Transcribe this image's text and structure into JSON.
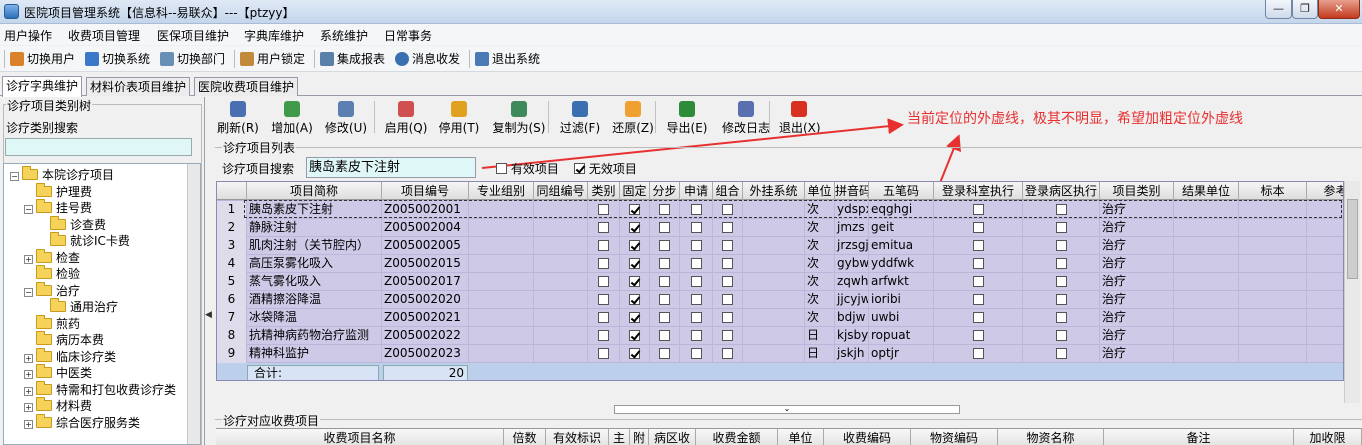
{
  "window": {
    "title": "医院项目管理系统【信息科--易联众】---【ptzyy】",
    "min_label": "—",
    "max_label": "❐",
    "close_label": "✕"
  },
  "menu": [
    "用户操作",
    "收费项目管理",
    "医保项目维护",
    "字典库维护",
    "系统维护",
    "日常事务"
  ],
  "toolbar": [
    {
      "label": "切换用户",
      "icon": "switch-user-icon",
      "color": "#d9822b"
    },
    {
      "label": "切换系统",
      "icon": "switch-system-icon",
      "color": "#3b78c8"
    },
    {
      "label": "切换部门",
      "icon": "switch-dept-icon",
      "color": "#6a8fb7"
    },
    {
      "label": "用户锁定",
      "icon": "user-lock-icon",
      "color": "#c28a3a"
    },
    {
      "label": "集成报表",
      "icon": "report-icon",
      "color": "#5a7fa8"
    },
    {
      "label": "消息收发",
      "icon": "info-icon",
      "color": "#3a6fb0"
    },
    {
      "label": "退出系统",
      "icon": "exit-icon",
      "color": "#4a7ab5"
    }
  ],
  "tabs": [
    "诊疗字典维护",
    "材料价表项目维护",
    "医院收费项目维护"
  ],
  "left": {
    "group_title": "诊疗项目类别树",
    "search_label": "诊疗类别搜索",
    "tree": [
      {
        "label": "本院诊疗项目",
        "level": 0,
        "exp": "−"
      },
      {
        "label": "护理费",
        "level": 1,
        "exp": ""
      },
      {
        "label": "挂号费",
        "level": 1,
        "exp": "−"
      },
      {
        "label": "诊查费",
        "level": 2,
        "exp": ""
      },
      {
        "label": "就诊IC卡费",
        "level": 2,
        "exp": ""
      },
      {
        "label": "检查",
        "level": 1,
        "exp": "+"
      },
      {
        "label": "检验",
        "level": 1,
        "exp": ""
      },
      {
        "label": "治疗",
        "level": 1,
        "exp": "−"
      },
      {
        "label": "通用治疗",
        "level": 2,
        "exp": ""
      },
      {
        "label": "煎药",
        "level": 1,
        "exp": ""
      },
      {
        "label": "病历本费",
        "level": 1,
        "exp": ""
      },
      {
        "label": "临床诊疗类",
        "level": 1,
        "exp": "+"
      },
      {
        "label": "中医类",
        "level": 1,
        "exp": "+"
      },
      {
        "label": "特需和打包收费诊疗类",
        "level": 1,
        "exp": "+"
      },
      {
        "label": "材料费",
        "level": 1,
        "exp": "+"
      },
      {
        "label": "综合医疗服务类",
        "level": 1,
        "exp": "+"
      }
    ]
  },
  "actions": [
    {
      "label": "刷新(R)",
      "icon": "refresh-icon",
      "color": "#4a6fb0"
    },
    {
      "label": "增加(A)",
      "icon": "add-icon",
      "color": "#3f9b4a"
    },
    {
      "label": "修改(U)",
      "icon": "edit-icon",
      "color": "#5a7fb0"
    },
    {
      "label": "启用(Q)",
      "icon": "enable-icon",
      "color": "#d05050"
    },
    {
      "label": "停用(T)",
      "icon": "disable-hand-icon",
      "color": "#e0a020"
    },
    {
      "label": "复制为(S)",
      "icon": "copy-icon",
      "color": "#3f8a5a"
    },
    {
      "label": "过滤(F)",
      "icon": "filter-icon",
      "color": "#3a6fb0"
    },
    {
      "label": "还原(Z)",
      "icon": "restore-icon",
      "color": "#f0a030"
    },
    {
      "label": "导出(E)",
      "icon": "excel-export-icon",
      "color": "#2e8b3a"
    },
    {
      "label": "修改日志",
      "icon": "log-icon",
      "color": "#5a6fb0"
    },
    {
      "label": "退出(X)",
      "icon": "exit-power-icon",
      "color": "#d83020"
    }
  ],
  "annotation": "当前定位的外虚线，极其不明显，希望加粗定位外虚线",
  "list": {
    "group_title": "诊疗项目列表",
    "search_label": "诊疗项目搜索",
    "search_value": "胰岛素皮下注射",
    "chk_valid": "有效项目",
    "chk_valid_checked": false,
    "chk_invalid": "无效项目",
    "chk_invalid_checked": true
  },
  "grid": {
    "columns": [
      "",
      "项目简称",
      "项目编号",
      "专业组别",
      "同组编号",
      "类别",
      "固定",
      "分步",
      "申请",
      "组合",
      "外挂系统",
      "单位",
      "拼音码",
      "五笔码",
      "登录科室执行",
      "登录病区执行",
      "项目类别",
      "结果单位",
      "标本",
      "参考值"
    ],
    "rows": [
      {
        "n": "1",
        "name": "胰岛素皮下注射",
        "code": "Z005002001",
        "fixed": true,
        "unit": "次",
        "py": "ydspxz",
        "wb": "eqghgi",
        "cat": "治疗"
      },
      {
        "n": "2",
        "name": "静脉注射",
        "code": "Z005002004",
        "fixed": true,
        "unit": "次",
        "py": "jmzs",
        "wb": "geit",
        "cat": "治疗"
      },
      {
        "n": "3",
        "name": "肌肉注射（关节腔内）",
        "code": "Z005002005",
        "fixed": true,
        "unit": "次",
        "py": "jrzsgj",
        "wb": "emitua",
        "cat": "治疗"
      },
      {
        "n": "4",
        "name": "高压泵雾化吸入",
        "code": "Z005002015",
        "fixed": true,
        "unit": "次",
        "py": "gybwhx",
        "wb": "yddfwk",
        "cat": "治疗"
      },
      {
        "n": "5",
        "name": "蒸气雾化吸入",
        "code": "Z005002017",
        "fixed": true,
        "unit": "次",
        "py": "zqwhxr",
        "wb": "arfwkt",
        "cat": "治疗"
      },
      {
        "n": "6",
        "name": "酒精擦浴降温",
        "code": "Z005002020",
        "fixed": true,
        "unit": "次",
        "py": "jjcyjw",
        "wb": "ioribi",
        "cat": "治疗"
      },
      {
        "n": "7",
        "name": "冰袋降温",
        "code": "Z005002021",
        "fixed": true,
        "unit": "次",
        "py": "bdjw",
        "wb": "uwbi",
        "cat": "治疗"
      },
      {
        "n": "8",
        "name": "抗精神病药物治疗监测",
        "code": "Z005002022",
        "fixed": true,
        "unit": "日",
        "py": "kjsbyw",
        "wb": "ropuat",
        "cat": "治疗"
      },
      {
        "n": "9",
        "name": "精神科监护",
        "code": "Z005002023",
        "fixed": true,
        "unit": "日",
        "py": "jskjh",
        "wb": "optjr",
        "cat": "治疗"
      }
    ],
    "sum_label": "合计:",
    "sum_value": "20"
  },
  "bottom": {
    "group_title": "诊疗对应收费项目",
    "columns": [
      "收费项目名称",
      "倍数",
      "有效标识",
      "主",
      "附",
      "病区收",
      "收费金额",
      "单位",
      "收费编码",
      "物资编码",
      "物资名称",
      "备注",
      "加收限"
    ]
  }
}
